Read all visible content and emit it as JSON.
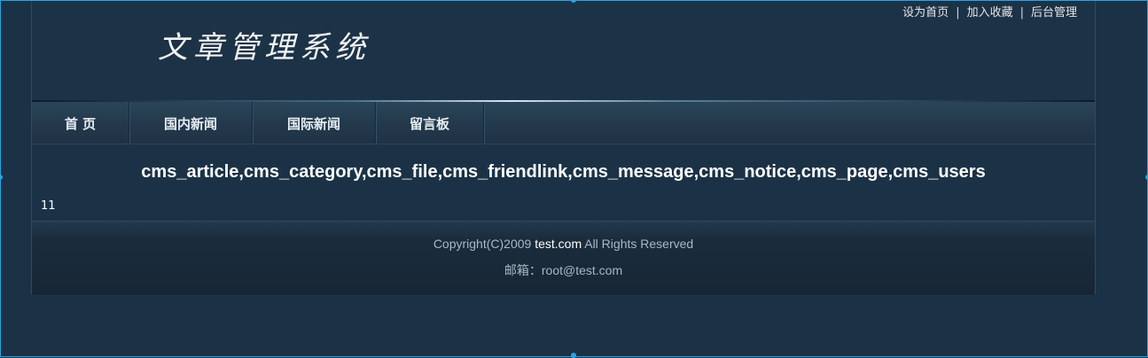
{
  "header": {
    "logo_text": "文章管理系统",
    "links": [
      "设为首页",
      "加入收藏",
      "后台管理"
    ],
    "separator": "|"
  },
  "nav": {
    "items": [
      "首 页",
      "国内新闻",
      "国际新闻",
      "留言板"
    ]
  },
  "content": {
    "tables": "cms_article,cms_category,cms_file,cms_friendlink,cms_message,cms_notice,cms_page,cms_users",
    "count": "11"
  },
  "footer": {
    "copyright_prefix": "Copyright(C)2009",
    "site": "test.com",
    "copyright_suffix": "All Rights Reserved",
    "email_label": "邮箱：",
    "email": "root@test.com"
  },
  "colors": {
    "background": "#1b3246",
    "selection_border": "#2aa4e0"
  }
}
